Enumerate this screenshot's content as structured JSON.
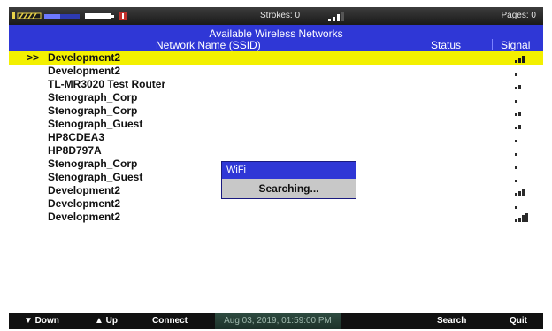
{
  "topbar": {
    "strokes": "Strokes: 0",
    "pages": "Pages: 0",
    "signal_level": 0.5
  },
  "header": {
    "title": "Available Wireless Networks",
    "col_ssid": "Network Name (SSID)",
    "col_status": "Status",
    "col_signal": "Signal"
  },
  "networks": [
    {
      "ssid": "Development2",
      "signal": 3,
      "selected": true,
      "marker": ">>"
    },
    {
      "ssid": "Development2",
      "signal": 1
    },
    {
      "ssid": "TL-MR3020 Test Router",
      "signal": 2
    },
    {
      "ssid": "Stenograph_Corp",
      "signal": 1
    },
    {
      "ssid": "Stenograph_Corp",
      "signal": 2
    },
    {
      "ssid": "Stenograph_Guest",
      "signal": 2
    },
    {
      "ssid": "HP8CDEA3",
      "signal": 1
    },
    {
      "ssid": "HP8D797A",
      "signal": 1
    },
    {
      "ssid": "Stenograph_Corp",
      "signal": 1
    },
    {
      "ssid": "Stenograph_Guest",
      "signal": 1
    },
    {
      "ssid": "Development2",
      "signal": 3
    },
    {
      "ssid": "Development2",
      "signal": 1
    },
    {
      "ssid": "Development2",
      "signal": 4
    }
  ],
  "popup": {
    "title": "WiFi",
    "message": "Searching..."
  },
  "bottombar": {
    "down": "▼ Down",
    "up": "▲ Up",
    "connect": "Connect",
    "datetime": "Aug 03, 2019, 01:59:00 PM",
    "search": "Search",
    "quit": "Quit"
  },
  "colors": {
    "header_blue": "#2f37d6",
    "selected_yellow": "#f3f000"
  }
}
